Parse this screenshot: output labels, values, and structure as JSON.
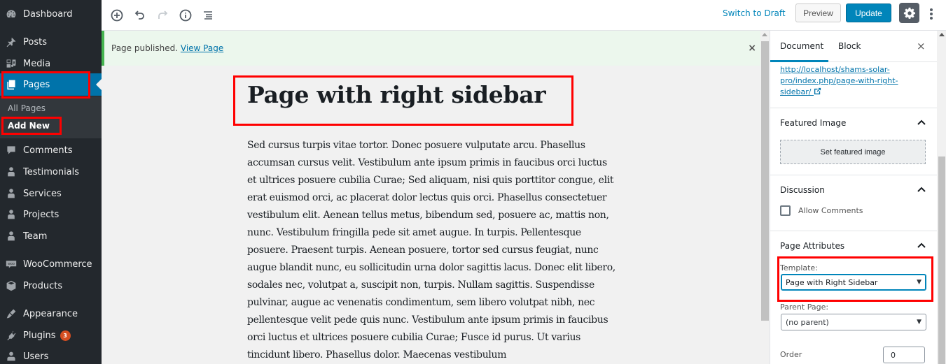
{
  "admin_menu": {
    "items": [
      {
        "label": "Dashboard",
        "icon": "dashboard-icon"
      },
      {
        "label": "Posts",
        "icon": "pushpin-icon"
      },
      {
        "label": "Media",
        "icon": "media-icon"
      },
      {
        "label": "Pages",
        "icon": "pages-icon",
        "current": true
      },
      {
        "label": "Comments",
        "icon": "comment-icon"
      },
      {
        "label": "Testimonials",
        "icon": "person-icon"
      },
      {
        "label": "Services",
        "icon": "person-icon"
      },
      {
        "label": "Projects",
        "icon": "person-icon"
      },
      {
        "label": "Team",
        "icon": "person-icon"
      },
      {
        "label": "WooCommerce",
        "icon": "woocommerce-icon"
      },
      {
        "label": "Products",
        "icon": "box-icon"
      },
      {
        "label": "Appearance",
        "icon": "paintbrush-icon"
      },
      {
        "label": "Plugins",
        "icon": "plug-icon",
        "badge": "3"
      },
      {
        "label": "Users",
        "icon": "users-icon"
      }
    ],
    "submenu": [
      {
        "label": "All Pages"
      },
      {
        "label": "Add New",
        "active": true
      }
    ]
  },
  "toolbar": {
    "icons": [
      "add-block-icon",
      "undo-icon",
      "redo-icon",
      "info-icon",
      "outline-icon"
    ],
    "switch_to_draft": "Switch to Draft",
    "preview": "Preview",
    "update": "Update"
  },
  "notice": {
    "text": "Page published.",
    "link": "View Page",
    "close": "×"
  },
  "post": {
    "title": "Page with right sidebar",
    "content": "Sed cursus turpis vitae tortor. Donec posuere vulputate arcu. Phasellus accumsan cursus velit. Vestibulum ante ipsum primis in faucibus orci luctus et ultrices posuere cubilia Curae; Sed aliquam, nisi quis porttitor congue, elit erat euismod orci, ac placerat dolor lectus quis orci. Phasellus consectetuer vestibulum elit. Aenean tellus metus, bibendum sed, posuere ac, mattis non, nunc. Vestibulum fringilla pede sit amet augue. In turpis. Pellentesque posuere. Praesent turpis. Aenean posuere, tortor sed cursus feugiat, nunc augue blandit nunc, eu sollicitudin urna dolor sagittis lacus. Donec elit libero, sodales nec, volutpat a, suscipit non, turpis. Nullam sagittis. Suspendisse pulvinar, augue ac venenatis condimentum, sem libero volutpat nibh, nec pellentesque velit pede quis nunc. Vestibulum ante ipsum primis in faucibus orci luctus et ultrices posuere cubilia Curae; Fusce id purus. Ut varius tincidunt libero. Phasellus dolor. Maecenas vestibulum"
  },
  "settings_sidebar": {
    "tabs": [
      {
        "label": "Document",
        "active": true
      },
      {
        "label": "Block"
      }
    ],
    "close": "×",
    "permalink": "http://localhost/shams-solar-pro/index.php/page-with-right-sidebar/",
    "featured_image": {
      "title": "Featured Image",
      "button": "Set featured image"
    },
    "discussion": {
      "title": "Discussion",
      "allow_comments_label": "Allow Comments",
      "allow_comments_checked": false
    },
    "page_attributes": {
      "title": "Page Attributes",
      "template_label": "Template:",
      "template_value": "Page with Right Sidebar",
      "parent_label": "Parent Page:",
      "parent_value": "(no parent)",
      "order_label": "Order",
      "order_value": "0"
    }
  },
  "colors": {
    "sidebar_bg": "#23282d",
    "accent": "#0085ba",
    "current_menu": "#0073aa",
    "notice_green": "#46b450",
    "highlight_red": "#ff0000"
  }
}
